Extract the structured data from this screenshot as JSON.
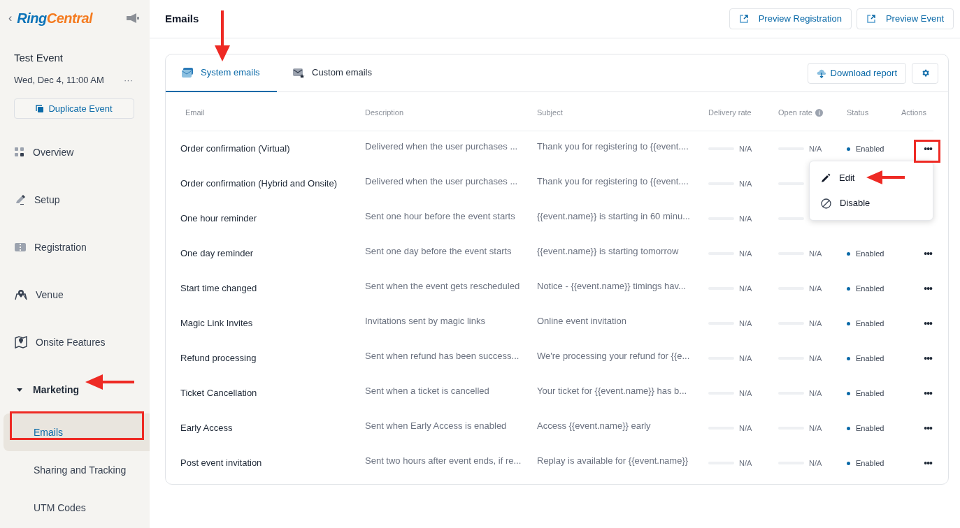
{
  "sidebar": {
    "back": "‹",
    "logo": [
      "Ring",
      "Central"
    ],
    "event_title": "Test Event",
    "event_date": "Wed, Dec 4, 11:00 AM",
    "more": "···",
    "duplicate_button": "Duplicate Event",
    "nav": [
      {
        "label": "Overview",
        "selected": false
      },
      {
        "label": "Setup",
        "selected": false
      },
      {
        "label": "Registration",
        "selected": false
      },
      {
        "label": "Venue",
        "selected": false
      },
      {
        "label": "Onsite Features",
        "selected": false
      },
      {
        "label": "Marketing",
        "selected": false,
        "expanded": true,
        "children": [
          {
            "label": "Emails",
            "selected": true
          },
          {
            "label": "Sharing and Tracking",
            "selected": false
          },
          {
            "label": "UTM Codes",
            "selected": false
          }
        ]
      }
    ]
  },
  "header": {
    "title": "Emails",
    "buttons": [
      "Preview Registration",
      "Preview Event"
    ]
  },
  "tabs": [
    {
      "label": "System emails",
      "selected": true
    },
    {
      "label": "Custom emails",
      "selected": false
    }
  ],
  "download_button": "Download report",
  "table": {
    "columns": [
      "Email",
      "Description",
      "Subject",
      "Delivery rate",
      "Open rate",
      "Status",
      "Actions"
    ],
    "rows": [
      {
        "email": "Order confirmation (Virtual)",
        "description": "Delivered when the user purchases ...",
        "subject": "Thank you for registering to {{event....",
        "delivery": "N/A",
        "open": "N/A",
        "status": "Enabled",
        "actions": "•••"
      },
      {
        "email": "Order confirmation (Hybrid and Onsite)",
        "description": "Delivered when the user purchases ...",
        "subject": "Thank you for registering to {{event....",
        "delivery": "N/A"
      },
      {
        "email": "One hour reminder",
        "description": "Sent one hour before the event starts",
        "subject": "{{event.name}} is starting in 60 minu...",
        "delivery": "N/A"
      },
      {
        "email": "One day reminder",
        "description": "Sent one day before the event starts",
        "subject": "{{event.name}} is starting tomorrow",
        "delivery": "N/A",
        "open": "N/A",
        "status": "Enabled",
        "actions": "•••"
      },
      {
        "email": "Start time changed",
        "description": "Sent when the event gets rescheduled",
        "subject": "Notice - {{event.name}} timings hav...",
        "delivery": "N/A",
        "open": "N/A",
        "status": "Enabled",
        "actions": "•••"
      },
      {
        "email": "Magic Link Invites",
        "description": "Invitations sent by magic links",
        "subject": "Online event invitation",
        "delivery": "N/A",
        "open": "N/A",
        "status": "Enabled",
        "actions": "•••"
      },
      {
        "email": "Refund processing",
        "description": "Sent when refund has been success...",
        "subject": "We're processing your refund for {{e...",
        "delivery": "N/A",
        "open": "N/A",
        "status": "Enabled",
        "actions": "•••"
      },
      {
        "email": "Ticket Cancellation",
        "description": "Sent when a ticket is cancelled",
        "subject": "Your ticket for {{event.name}} has b...",
        "delivery": "N/A",
        "open": "N/A",
        "status": "Enabled",
        "actions": "•••"
      },
      {
        "email": "Early Access",
        "description": "Sent when Early Access is enabled",
        "subject": "Access {{event.name}} early",
        "delivery": "N/A",
        "open": "N/A",
        "status": "Enabled",
        "actions": "•••"
      },
      {
        "email": "Post event invitation",
        "description": "Sent two hours after event ends, if re...",
        "subject": "Replay is available for {{event.name}}",
        "delivery": "N/A",
        "open": "N/A",
        "status": "Enabled",
        "actions": "•••"
      }
    ]
  },
  "row_menu": {
    "items": [
      "Edit",
      "Disable"
    ]
  }
}
